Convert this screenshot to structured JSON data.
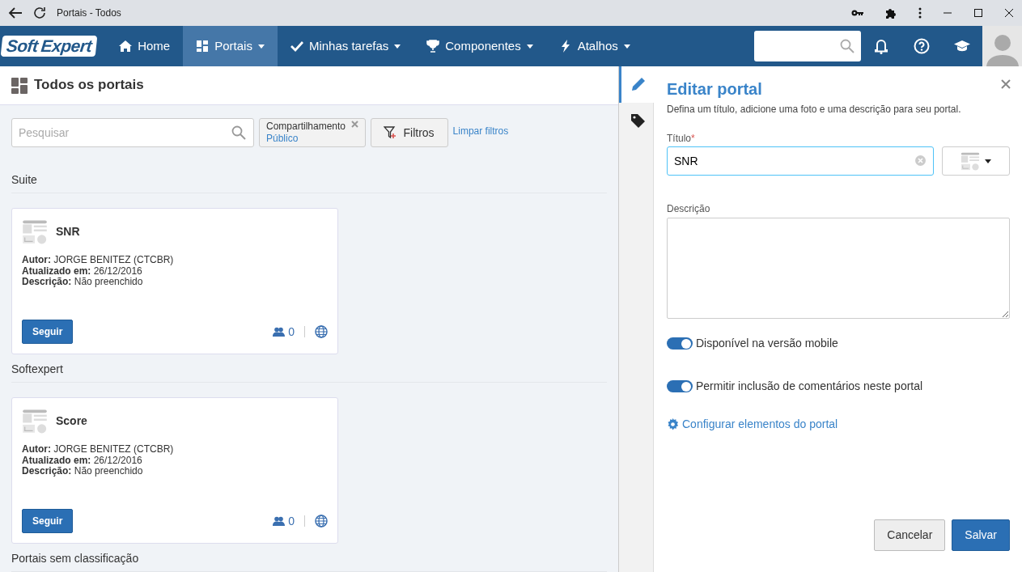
{
  "browser": {
    "title": "Portais - Todos"
  },
  "navbar": {
    "logo": [
      "Soft",
      "Expert"
    ],
    "items": [
      {
        "label": "Home",
        "kind": "home",
        "selected": false
      },
      {
        "label": "Portais",
        "kind": "grid",
        "selected": true
      },
      {
        "label": "Minhas tarefas",
        "kind": "check",
        "selected": false
      },
      {
        "label": "Componentes",
        "kind": "trophy",
        "selected": false
      },
      {
        "label": "Atalhos",
        "kind": "bolt",
        "selected": false
      }
    ]
  },
  "page_title": "Todos os portais",
  "search": {
    "placeholder": "Pesquisar"
  },
  "filter_chip": {
    "label": "Compartilhamento",
    "value": "Público"
  },
  "filters_button": "Filtros",
  "clear_filters": "Limpar filtros",
  "groups": [
    {
      "name": "Suite",
      "portals": [
        {
          "title": "SNR",
          "lines": [
            "**Autor:** JORGE BENITEZ (CTCBR)",
            "**Atualizado em:** 26/12/2016",
            "**Descrição:** Não preenchido"
          ],
          "button": "Seguir",
          "followers": "0"
        }
      ]
    },
    {
      "name": "Softexpert",
      "portals": [
        {
          "title": "Score",
          "lines": [
            "**Autor:** JORGE BENITEZ (CTCBR)",
            "**Atualizado em:** 26/12/2016",
            "**Descrição:** Não preenchido"
          ],
          "button": "Seguir",
          "followers": "0"
        }
      ]
    },
    {
      "name": "Portais sem classificação"
    }
  ],
  "panel": {
    "tabs": [
      {
        "kind": "edit",
        "selected": true
      },
      {
        "kind": "tag",
        "selected": false
      }
    ],
    "title": "Editar portal",
    "subtitle": "Defina um título, adicione uma foto e uma descrição para seu portal.",
    "title_label": "Título",
    "required_mark": "*",
    "title_value": "SNR",
    "description_label": "Descrição",
    "toggles": [
      {
        "label": "Disponível na versão mobile",
        "on": true
      },
      {
        "label": "Permitir inclusão de comentários neste portal",
        "on": true
      }
    ],
    "config_link": "Configurar elementos do portal",
    "cancel": "Cancelar",
    "save": "Salvar"
  }
}
